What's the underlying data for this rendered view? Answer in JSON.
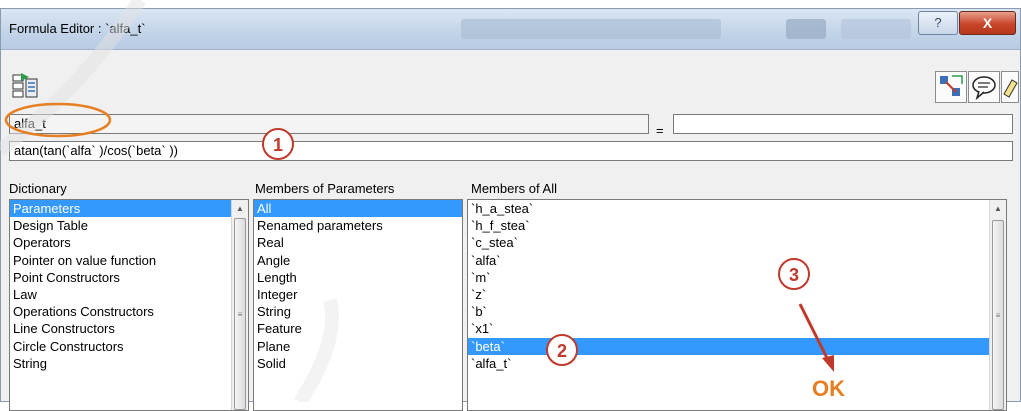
{
  "window": {
    "title": "Formula Editor : `alfa_t`",
    "help_glyph": "?",
    "close_glyph": "X"
  },
  "toolbar": {
    "left_icon": "import-parameter-icon",
    "right_icons": [
      "measure-icon",
      "comment-balloon-icon",
      "eraser-icon"
    ]
  },
  "parameter_name": "alfa_t",
  "equals_sign": "=",
  "formula": "atan(tan(`alfa` )/cos(`beta` ))",
  "dictionary": {
    "header": "Dictionary",
    "items": [
      "Parameters",
      "Design Table",
      "Operators",
      "Pointer on value function",
      "Point Constructors",
      "Law",
      "Operations Constructors",
      "Line Constructors",
      "Circle Constructors",
      "String"
    ],
    "selected_index": 0
  },
  "members_of_parameters": {
    "header": "Members of Parameters",
    "items": [
      "All",
      "Renamed parameters",
      "Real",
      "Angle",
      "Length",
      "Integer",
      "String",
      "Feature",
      "Plane",
      "Solid"
    ],
    "selected_index": 0
  },
  "members_of_all": {
    "header": "Members of All",
    "items": [
      "`h_a_stea`",
      "`h_f_stea`",
      "`c_stea`",
      "`alfa`",
      "`m`",
      "`z`",
      "`b`",
      "`x1`",
      "`beta`",
      "`alfa_t`"
    ],
    "selected_index": 8
  },
  "annotations": {
    "step1": "1",
    "step2": "2",
    "step3": "3",
    "ok": "OK",
    "color_marker": "#c0392b",
    "color_ok": "#e67e22",
    "color_highlight_ring": "#e67e22"
  },
  "colors": {
    "selection": "#3399ff",
    "title_bar": "#c6d6ea",
    "close_button": "#c9452a"
  }
}
